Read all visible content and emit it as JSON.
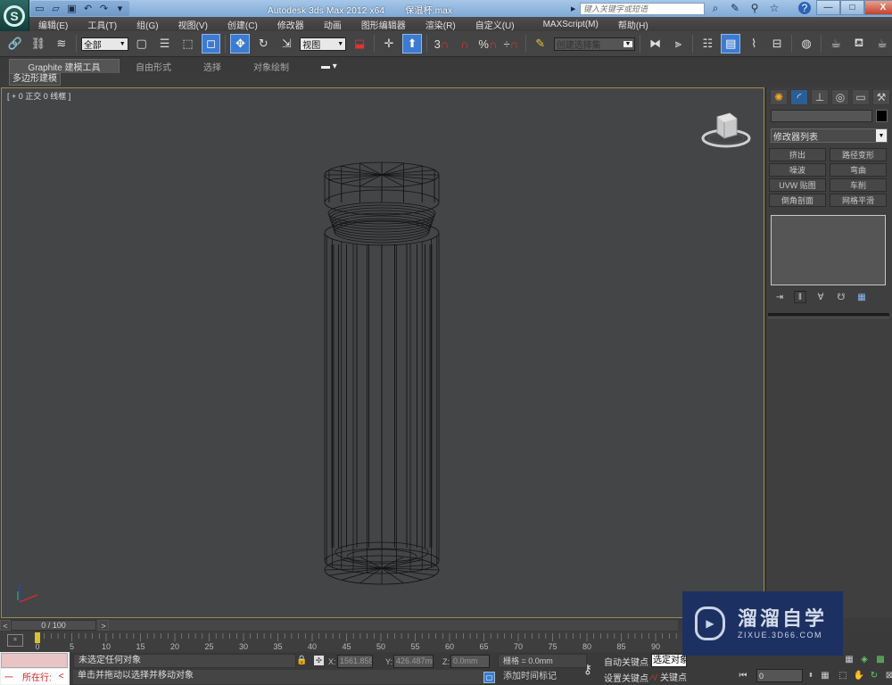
{
  "titlebar": {
    "app_title": "Autodesk 3ds Max  2012 x64",
    "file_name": "保温杯.max",
    "search_placeholder": "键入关键字或短语",
    "quick_access": [
      "new-file-icon",
      "open-file-icon",
      "save-icon",
      "undo-icon",
      "redo-icon",
      "customize-icon"
    ],
    "title_icons": [
      "binoculars-icon",
      "wrench-icon",
      "satellite-icon",
      "star-icon",
      "help-icon"
    ],
    "window_controls": {
      "minimize": "—",
      "maximize": "□",
      "close": "X"
    }
  },
  "menu": {
    "items": [
      "编辑(E)",
      "工具(T)",
      "组(G)",
      "视图(V)",
      "创建(C)",
      "修改器",
      "动画",
      "图形编辑器",
      "渲染(R)",
      "自定义(U)",
      "MAXScript(M)",
      "帮助(H)"
    ]
  },
  "toolbar": {
    "selection_filter": "全部",
    "ref_coord": "视图",
    "named_selection": "创建选择集",
    "snap_labels": {
      "snap3": "3",
      "angle": "%",
      "spinner": "÷"
    }
  },
  "ribbon": {
    "tabs": [
      "Graphite 建模工具",
      "自由形式",
      "选择",
      "对象绘制"
    ],
    "active_tab": 0,
    "subtab": "多边形建模"
  },
  "viewport": {
    "label": "[ + 0 正交 0 线框 ]",
    "object": "thermos-cup-wireframe"
  },
  "command_panel": {
    "tabs": [
      "create-icon",
      "modify-icon",
      "hierarchy-icon",
      "motion-icon",
      "display-icon",
      "utilities-icon"
    ],
    "active_tab": 1,
    "object_name": "",
    "object_color": "#000000",
    "modifier_list": "修改器列表",
    "modifier_buttons": [
      "挤出",
      "路径变形",
      "噪波",
      "弯曲",
      "UVW 贴图",
      "车削",
      "倒角剖面",
      "网格平滑"
    ]
  },
  "timeline": {
    "frame_display": "0 / 100",
    "prev": "<",
    "next": ">",
    "ticks": [
      0,
      5,
      10,
      15,
      20,
      25,
      30,
      35,
      40,
      45,
      50,
      55,
      60,
      65,
      70,
      75,
      80,
      85,
      90
    ],
    "current_frame": 0
  },
  "status": {
    "maxscript_line": "所在行:",
    "maxscript_prefix": "一",
    "maxscript_arrow": "<",
    "prompt_selection": "未选定任何对象",
    "prompt_hint": "单击并拖动以选择并移动对象",
    "x_label": "X:",
    "x_value": "1561.858m",
    "y_label": "Y:",
    "y_value": "426.487mm",
    "z_label": "Z:",
    "z_value": "0.0mm",
    "grid": "栅格 = 0.0mm",
    "add_time_tag": "添加时间标记",
    "auto_key": "自动关键点",
    "set_key": "设置关键点",
    "selection_set": "选定对象",
    "key_filters": "关键点过滤器...",
    "frame_input": "0"
  },
  "watermark": {
    "title": "溜溜自学",
    "url": "ZIXUE.3D66.COM"
  },
  "colors": {
    "viewport_bg": "#444547",
    "viewport_border": "#9b8a4b",
    "active_blue": "#3d7bd0",
    "watermark_bg": "#1d3062"
  }
}
